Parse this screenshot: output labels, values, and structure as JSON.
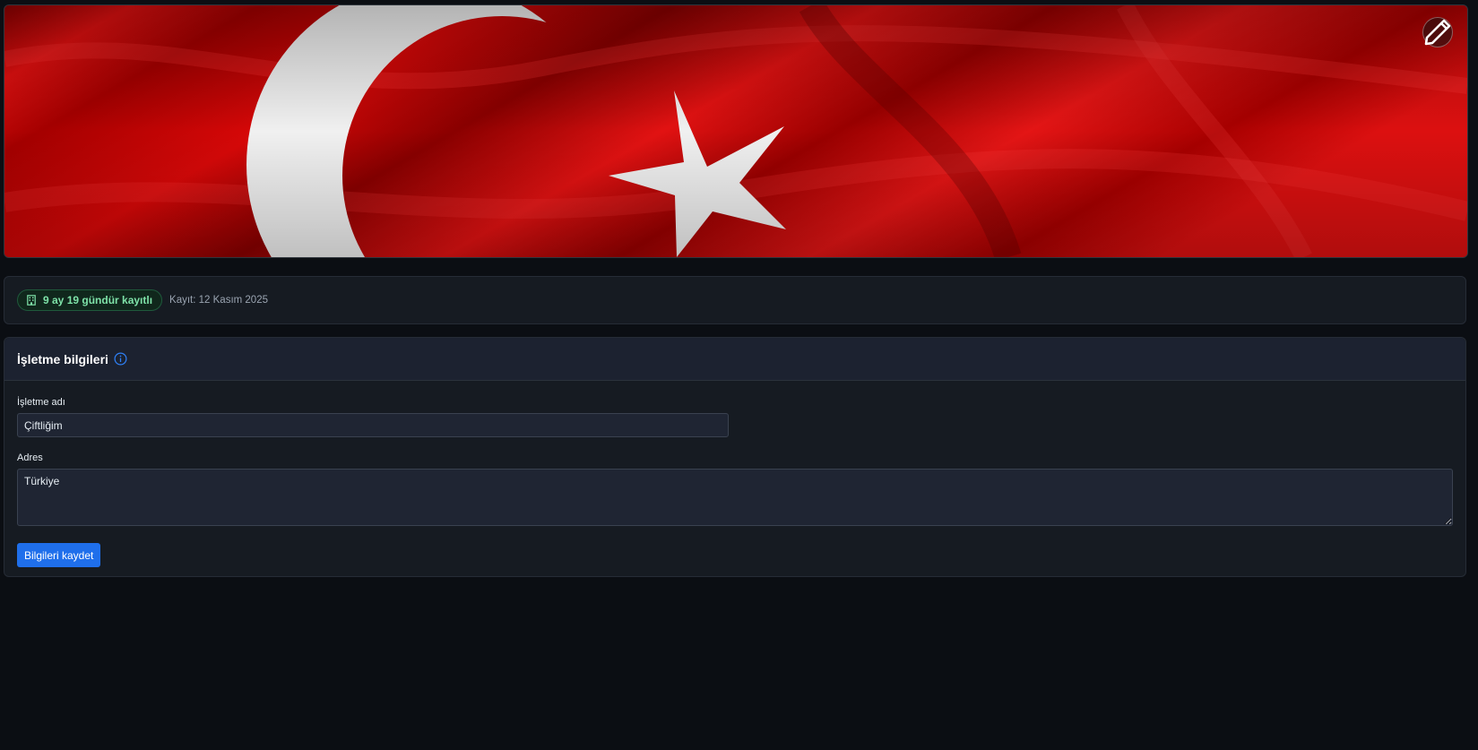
{
  "banner": {
    "alt": "Türk bayrağı",
    "edit_icon": "pencil-icon",
    "colors": {
      "flag_red": "#d10000",
      "flag_white": "#f2f2f2"
    }
  },
  "meta": {
    "badge_icon": "building-icon",
    "badge_text": "9 ay 19 gündür kayıtlı",
    "registered_text": "Kayıt: 12 Kasım 2025",
    "badge_color": "#7ee2a8"
  },
  "business": {
    "title": "İşletme bilgileri",
    "info_icon": "info-icon",
    "name_label": "İşletme adı",
    "name_value": "Çiftliğim",
    "address_label": "Adres",
    "address_value": "Türkiye",
    "save_label": "Bilgileri kaydet",
    "accent_color": "#1f6feb"
  }
}
